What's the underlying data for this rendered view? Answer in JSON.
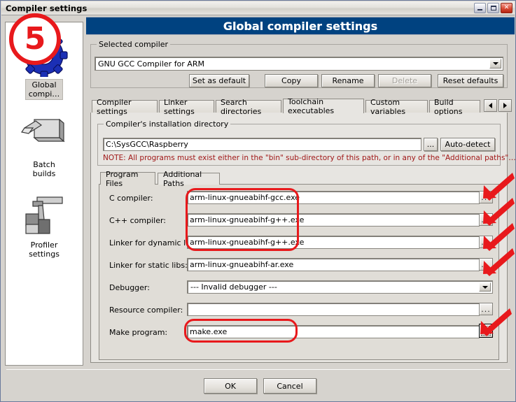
{
  "window": {
    "title": "Compiler settings",
    "minimize_label": "minimize",
    "maximize_label": "maximize",
    "close_label": "✕"
  },
  "header": {
    "title": "Global compiler settings"
  },
  "sidebar": {
    "items": [
      {
        "label": "Global\ncompi…",
        "icon": "gear-icon",
        "selected": true
      },
      {
        "label": "Batch\nbuilds",
        "icon": "batch-builds-icon",
        "selected": false
      },
      {
        "label": "Profiler\nsettings",
        "icon": "profiler-settings-icon",
        "selected": false
      }
    ]
  },
  "selected_compiler": {
    "legend": "Selected compiler",
    "value": "GNU GCC Compiler for ARM",
    "buttons": [
      {
        "label": "Set as default",
        "disabled": false
      },
      {
        "label": "Copy",
        "disabled": false
      },
      {
        "label": "Rename",
        "disabled": false
      },
      {
        "label": "Delete",
        "disabled": true
      },
      {
        "label": "Reset defaults",
        "disabled": false
      }
    ]
  },
  "tabs": {
    "items": [
      {
        "label": "Compiler settings",
        "active": false
      },
      {
        "label": "Linker settings",
        "active": false
      },
      {
        "label": "Search directories",
        "active": false
      },
      {
        "label": "Toolchain executables",
        "active": true
      },
      {
        "label": "Custom variables",
        "active": false
      },
      {
        "label": "Build options",
        "active": false
      }
    ],
    "nav_prev": "◄",
    "nav_next": "►"
  },
  "install_dir": {
    "legend": "Compiler's installation directory",
    "path": "C:\\SysGCC\\Raspberry",
    "browse_label": "...",
    "autodetect_label": "Auto-detect",
    "note": "NOTE: All programs must exist either in the \"bin\" sub-directory of this path, or in any of the \"Additional paths\"…"
  },
  "inner_tabs": [
    {
      "label": "Program Files",
      "active": true
    },
    {
      "label": "Additional Paths",
      "active": false
    }
  ],
  "program_files": {
    "browse_label": "...",
    "rows": [
      {
        "label": "C compiler:",
        "value": "arm-linux-gnueabihf-gcc.exe",
        "type": "text"
      },
      {
        "label": "C++ compiler:",
        "value": "arm-linux-gnueabihf-g++.exe",
        "type": "text"
      },
      {
        "label": "Linker for dynamic libs:",
        "value": "arm-linux-gnueabihf-g++.exe",
        "type": "text"
      },
      {
        "label": "Linker for static libs:",
        "value": "arm-linux-gnueabihf-ar.exe",
        "type": "text"
      },
      {
        "label": "Debugger:",
        "value": "--- Invalid debugger ---",
        "type": "combo"
      },
      {
        "label": "Resource compiler:",
        "value": "",
        "type": "text"
      },
      {
        "label": "Make program:",
        "value": "make.exe",
        "type": "text"
      }
    ]
  },
  "footer": {
    "ok_label": "OK",
    "cancel_label": "Cancel"
  },
  "annotations": {
    "step_number": "5",
    "accent_color": "#e8191c",
    "note_color": "#a01818",
    "header_color": "#004280"
  }
}
